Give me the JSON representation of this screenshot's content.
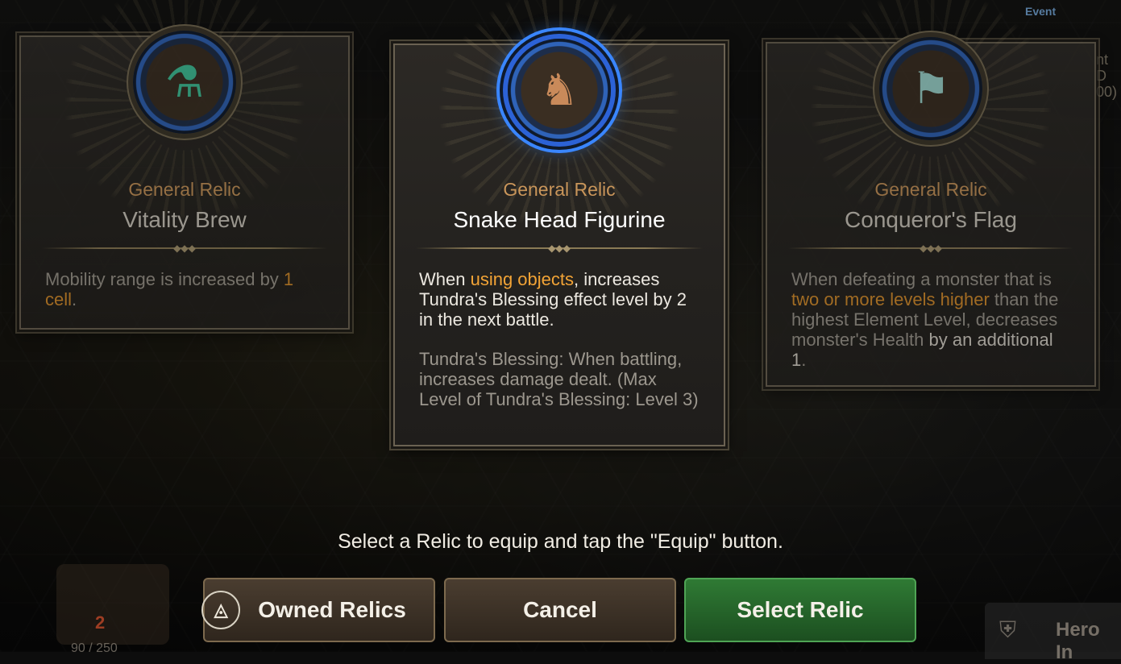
{
  "hud": {
    "event_label": "Event",
    "side_text_line1": "nt D",
    "side_text_line2": "00)",
    "chest_number": "2",
    "chest_count": "90 / 250",
    "hero_button_label": "Hero In"
  },
  "cards": [
    {
      "subtype": "General Relic",
      "name": "Vitality Brew",
      "icon": "potion-icon",
      "glyph": "⚗",
      "desc_parts": [
        {
          "text": "Mobility range is increased by ",
          "style": "muted"
        },
        {
          "text": "1 cell",
          "style": "hl"
        },
        {
          "text": ".",
          "style": "muted"
        }
      ]
    },
    {
      "subtype": "General Relic",
      "name": "Snake Head Figurine",
      "icon": "snake-figurine-icon",
      "glyph": "♞",
      "selected": true,
      "desc_p1": [
        {
          "text": "When ",
          "style": "normal"
        },
        {
          "text": "using objects",
          "style": "hl"
        },
        {
          "text": ", increases Tundra's Blessing effect level by 2 in the next battle.",
          "style": "normal"
        }
      ],
      "desc_p2": "Tundra's Blessing: When battling, increases damage dealt. (Max Level of Tundra's Blessing: Level 3)"
    },
    {
      "subtype": "General Relic",
      "name": "Conqueror's Flag",
      "icon": "flag-icon",
      "glyph": "⚑",
      "desc_parts": [
        {
          "text": "When defeating a monster that is ",
          "style": "muted"
        },
        {
          "text": "two or more levels higher",
          "style": "hl"
        },
        {
          "text": " than the highest Element Level, decreases monster's Health ",
          "style": "muted"
        },
        {
          "text": "by an additional 1",
          "style": "normal"
        },
        {
          "text": ".",
          "style": "muted"
        }
      ]
    }
  ],
  "hint": "Select a Relic to equip and tap the \"Equip\" button.",
  "buttons": {
    "owned_relics": "Owned Relics",
    "cancel": "Cancel",
    "select_relic": "Select Relic"
  },
  "colors": {
    "highlight": "#f3a436",
    "subtype": "#c9955a",
    "select_green": "#2f7a34",
    "selected_ring": "#3a86ff"
  }
}
